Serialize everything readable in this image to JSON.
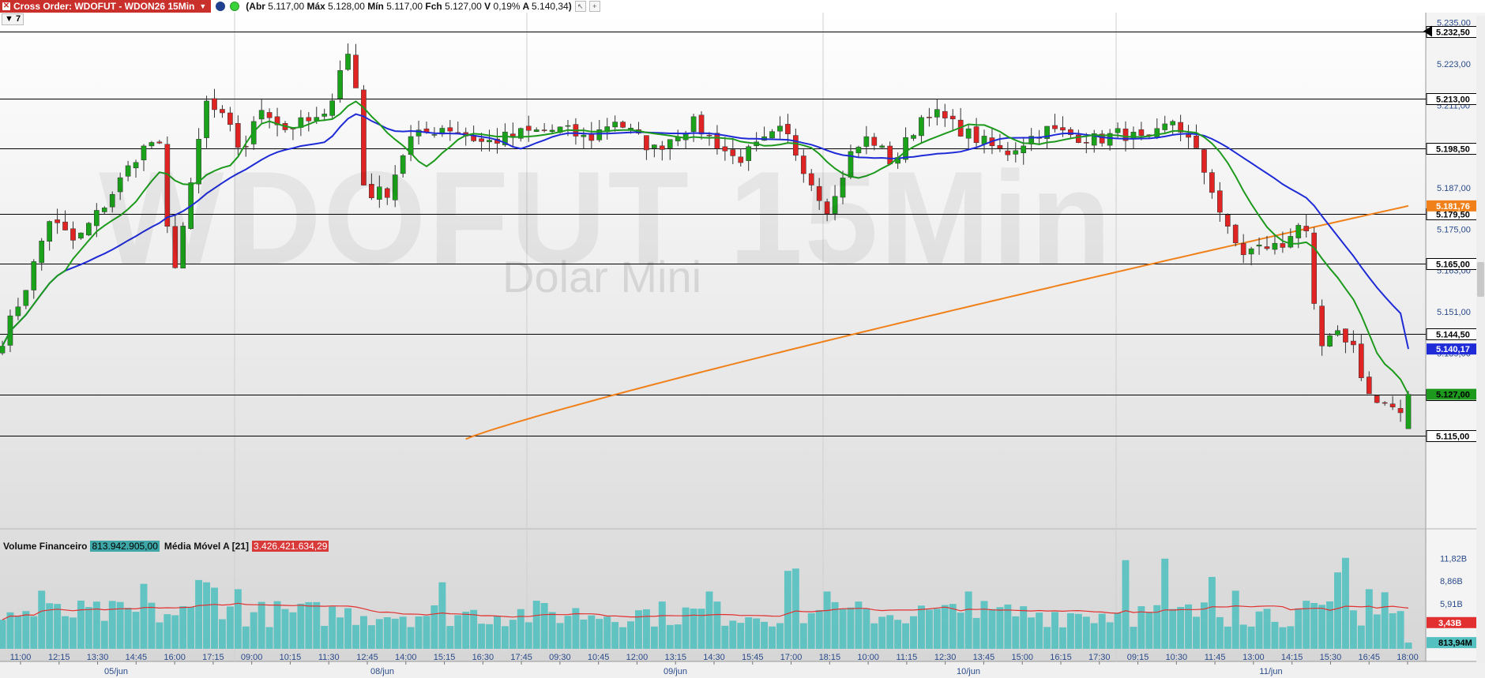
{
  "header": {
    "order_label": "Cross Order: WDOFUT - WDON26 15Min",
    "ohlc": {
      "open_label": "Abr",
      "open": "5.117,00",
      "high_label": "Máx",
      "high": "5.128,00",
      "low_label": "Mín",
      "low": "5.117,00",
      "close_label": "Fch",
      "close": "5.127,00",
      "change_label": "V",
      "change": "0,19%",
      "adjust_label": "A",
      "adjust": "5.140,34"
    },
    "timeframe_label": "7"
  },
  "watermark": {
    "symbol": "WDOFUT 15Min",
    "name": "Dolar Mini"
  },
  "volume_panel": {
    "title": "Volume Financeiro",
    "value": "813.942.905,00",
    "ma_title": "Média Móvel A [21]",
    "ma_value": "3.426.421.634,29"
  },
  "chart_data": {
    "type": "candlestick",
    "colors": {
      "up": "#1aa31a",
      "down": "#e02424",
      "ma_fast": "#1d9a1d",
      "ma_slow": "#1f2bd6",
      "ma_long": "#f0811a",
      "volume": "#54c0c0",
      "volume_ma": "#e23030",
      "hline": "#000000"
    },
    "price_axis": {
      "range": [
        5112,
        5237
      ],
      "ticks": [
        "5.235,00",
        "5.223,00",
        "5.211,00",
        "5.199,00",
        "5.187,00",
        "5.175,00",
        "5.163,00",
        "5.151,00",
        "5.139,00",
        "5.127,00",
        "5.115,00"
      ]
    },
    "horizontal_lines": [
      {
        "value": 5232.5,
        "label": "5.232,50"
      },
      {
        "value": 5213.0,
        "label": "5.213,00"
      },
      {
        "value": 5198.5,
        "label": "5.198,50"
      },
      {
        "value": 5179.5,
        "label": "5.179,50"
      },
      {
        "value": 5165.0,
        "label": "5.165,00"
      },
      {
        "value": 5144.5,
        "label": "5.144,50"
      },
      {
        "value": 5127.0,
        "label": "5.127,00"
      },
      {
        "value": 5115.0,
        "label": "5.115,00"
      }
    ],
    "current_labels": [
      {
        "value": 5181.76,
        "label": "5.181,76",
        "color": "#f0811a"
      },
      {
        "value": 5140.17,
        "label": "5.140,17",
        "color": "#1f2bd6"
      },
      {
        "value": 5127.0,
        "label": "5.127,00",
        "color": "#1d9a1d"
      }
    ],
    "volume_axis": {
      "range": [
        0,
        12.6
      ],
      "ticks": [
        {
          "value": 11.82,
          "label": "11,82B"
        },
        {
          "value": 8.86,
          "label": "8,86B"
        },
        {
          "value": 5.91,
          "label": "5,91B"
        }
      ],
      "current_labels": [
        {
          "value": 3.43,
          "label": "3,43B",
          "color": "#e23030"
        },
        {
          "value": 0.81,
          "label": "813,94M",
          "color": "#54c0c0"
        }
      ]
    },
    "time_ticks": [
      "11:00",
      "12:15",
      "13:30",
      "14:45",
      "16:00",
      "17:15",
      "09:00",
      "10:15",
      "11:30",
      "12:45",
      "14:00",
      "15:15",
      "16:30",
      "17:45",
      "09:30",
      "10:45",
      "12:00",
      "13:15",
      "14:30",
      "15:45",
      "17:00",
      "18:15",
      "10:00",
      "11:15",
      "12:30",
      "13:45",
      "15:00",
      "16:15",
      "17:30",
      "09:15",
      "10:30",
      "11:45",
      "13:00",
      "14:15",
      "15:30",
      "16:45",
      "18:00"
    ],
    "date_labels": [
      "05/jun",
      "08/jun",
      "09/jun",
      "10/jun",
      "11/jun"
    ],
    "candles_count": 180
  }
}
